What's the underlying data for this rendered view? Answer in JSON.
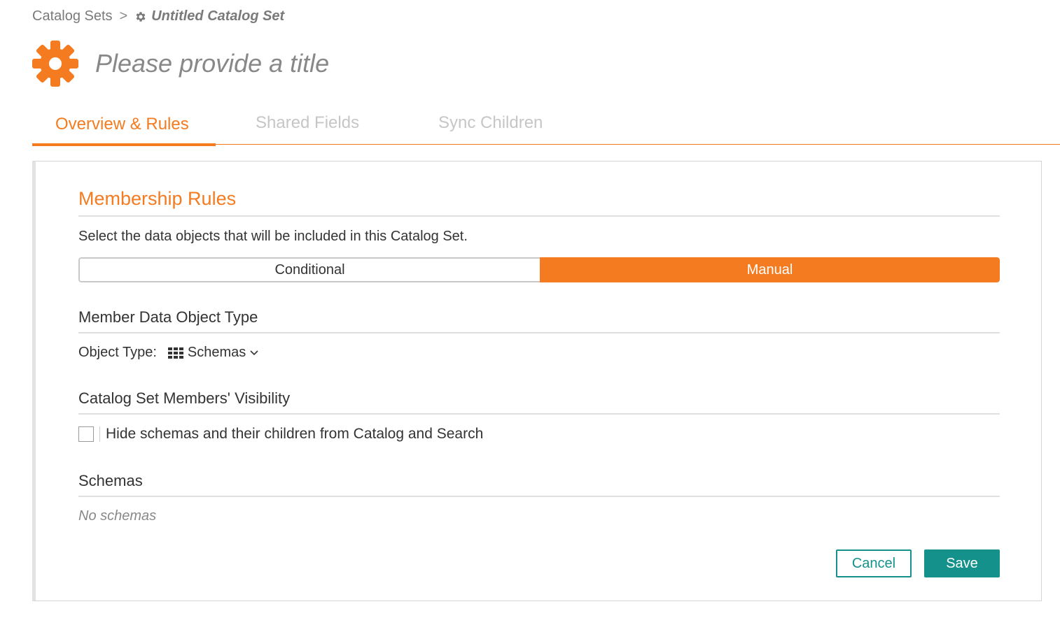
{
  "breadcrumb": {
    "parent": "Catalog Sets",
    "separator": ">",
    "current": "Untitled Catalog Set",
    "current_icon": "gear-icon"
  },
  "header": {
    "icon": "gear-icon",
    "icon_color": "#f47b20",
    "title_placeholder": "Please provide a title"
  },
  "tabs": [
    {
      "label": "Overview & Rules",
      "active": true
    },
    {
      "label": "Shared Fields",
      "active": false
    },
    {
      "label": "Sync Children",
      "active": false
    }
  ],
  "membership": {
    "heading": "Membership Rules",
    "description": "Select the data objects that will be included in this Catalog Set.",
    "modes": [
      "Conditional",
      "Manual"
    ],
    "selected_mode": "Manual"
  },
  "object_type": {
    "heading": "Member Data Object Type",
    "label": "Object Type:",
    "icon": "grid-icon",
    "value": "Schemas"
  },
  "visibility": {
    "heading": "Catalog Set Members' Visibility",
    "checkbox_label": "Hide schemas and their children from Catalog and Search",
    "checked": false
  },
  "schemas": {
    "heading": "Schemas",
    "empty_text": "No schemas"
  },
  "actions": {
    "cancel_label": "Cancel",
    "save_label": "Save"
  },
  "colors": {
    "accent": "#f47b20",
    "primary_button": "#13918a"
  }
}
